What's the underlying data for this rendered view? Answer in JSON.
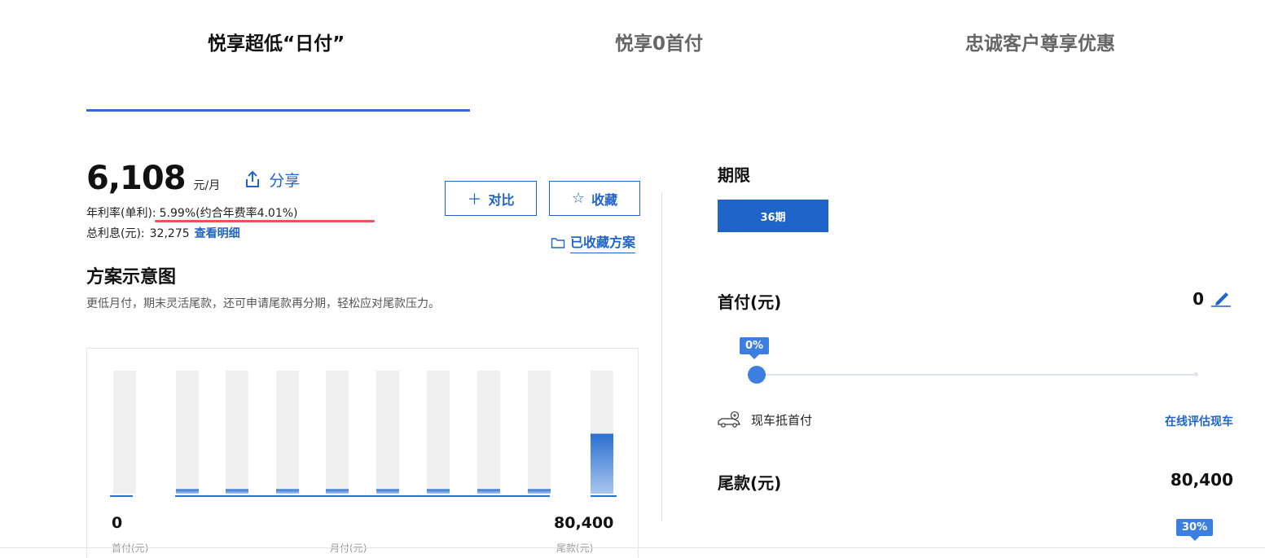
{
  "tabs": [
    {
      "label": "悦享超低“日付”",
      "active": true
    },
    {
      "label": "悦享0首付",
      "active": false
    },
    {
      "label": "忠诚客户尊享优惠",
      "active": false
    }
  ],
  "summary": {
    "monthly_payment": "6,108",
    "monthly_unit": "元/月",
    "share_label": "分享",
    "rate_label": "年利率(单利):",
    "rate_value": "5.99%(约合年费率4.01%)",
    "interest_label": "总利息(元):",
    "interest_value": "32,275",
    "interest_link": "查看明细"
  },
  "actions": {
    "compare_label": "对比",
    "favorite_label": "收藏",
    "saved_plans_label": "已收藏方案"
  },
  "plan": {
    "title": "方案示意图",
    "description": "更低月付，期末灵活尾款，还可申请尾款再分期，轻松应对尾款压力。"
  },
  "chart_data": {
    "type": "bar",
    "categories": [
      "首付",
      "月付",
      "月付",
      "月付",
      "月付",
      "月付",
      "月付",
      "月付",
      "月付",
      "尾款"
    ],
    "values": [
      0,
      6108,
      6108,
      6108,
      6108,
      6108,
      6108,
      6108,
      6108,
      80400
    ],
    "ylim": [
      0,
      165000
    ],
    "first_label": "0",
    "last_label": "80,400",
    "bottom_labels": [
      "首付(元)",
      "月付(元)",
      "尾款(元)"
    ],
    "colors": {
      "track": "#efefef",
      "fill": "#2a6fd1",
      "fill_light": "#a9c6ef"
    }
  },
  "right_panel": {
    "term_title": "期限",
    "term_selected": "36期",
    "down_title": "首付(元)",
    "down_value": "0",
    "down_slider_percent": 0,
    "down_slider_label": "0%",
    "trade_in_label": "现车抵首付",
    "trade_in_link": "在线评估现车",
    "balloon_title": "尾款(元)",
    "balloon_value": "80,400",
    "balloon_slider_label": "30%"
  }
}
